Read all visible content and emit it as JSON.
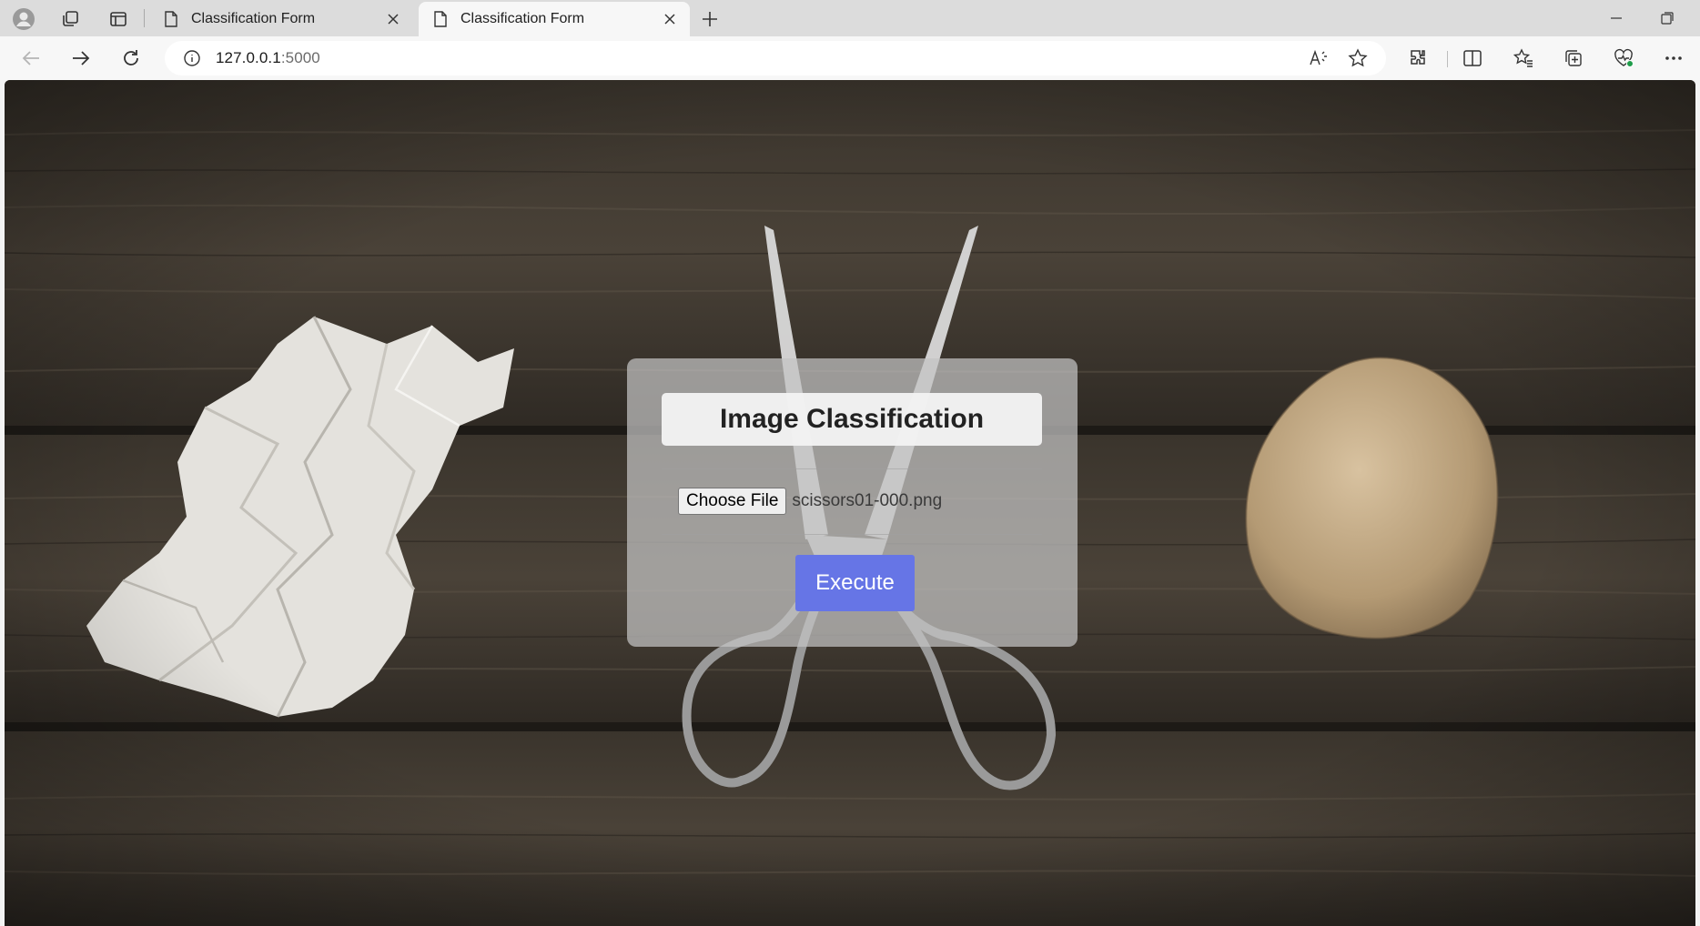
{
  "browser": {
    "tabs": [
      {
        "title": "Classification Form",
        "active": false
      },
      {
        "title": "Classification Form",
        "active": true
      }
    ],
    "address": {
      "host": "127.0.0.1",
      "port": ":5000"
    },
    "icons": [
      "profile-icon",
      "workspaces-icon",
      "vertical-tabs-icon",
      "new-tab-icon",
      "minimize-icon",
      "restore-icon",
      "back-icon",
      "forward-icon",
      "refresh-icon",
      "site-info-icon",
      "read-aloud-icon",
      "favorite-star-icon",
      "extensions-icon",
      "split-screen-icon",
      "favorites-icon",
      "collections-icon",
      "browser-essentials-icon",
      "more-icon"
    ]
  },
  "page": {
    "title": "Image Classification",
    "file_button_label": "Choose File",
    "file_name": "scissors01-000.png",
    "execute_label": "Execute",
    "accent_color": "#6675e6"
  }
}
